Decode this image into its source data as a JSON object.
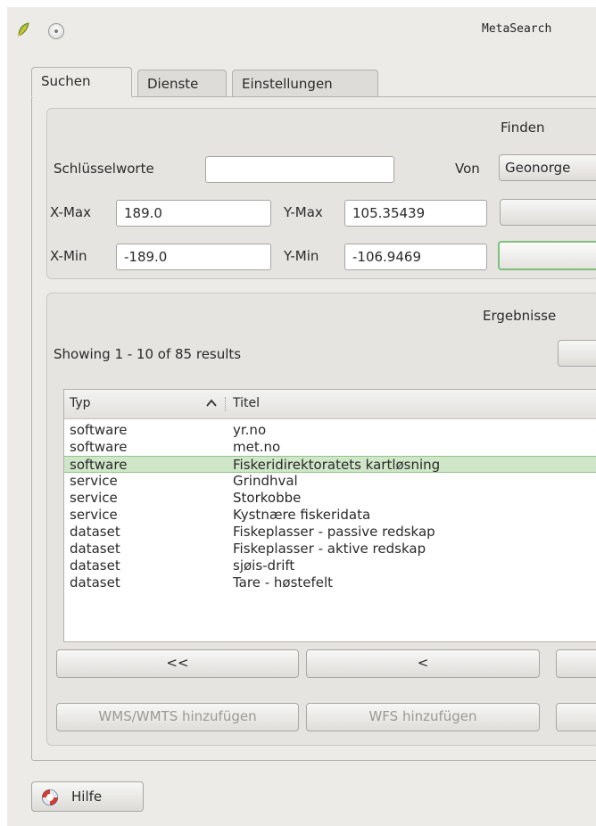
{
  "window": {
    "title": "MetaSearch"
  },
  "tabs": [
    {
      "label": "Suchen",
      "active": true
    },
    {
      "label": "Dienste",
      "active": false
    },
    {
      "label": "Einstellungen",
      "active": false
    }
  ],
  "search": {
    "group_title": "Finden",
    "keywords_label": "Schlüsselworte",
    "keywords_value": "",
    "from_label": "Von",
    "from_value": "Geonorge",
    "xmax_label": "X-Max",
    "xmax_value": "189.0",
    "ymax_label": "Y-Max",
    "ymax_value": "105.35439",
    "xmin_label": "X-Min",
    "xmin_value": "-189.0",
    "ymin_label": "Y-Min",
    "ymin_value": "-106.9469"
  },
  "results": {
    "group_title": "Ergebnisse",
    "summary": "Showing 1 - 10 of 85 results",
    "columns": [
      "Typ",
      "Titel"
    ],
    "rows": [
      {
        "type": "software",
        "title": "yr.no"
      },
      {
        "type": "software",
        "title": "met.no"
      },
      {
        "type": "software",
        "title": "Fiskeridirektoratets kartløsning"
      },
      {
        "type": "service",
        "title": "Grindhval"
      },
      {
        "type": "service",
        "title": "Storkobbe"
      },
      {
        "type": "service",
        "title": "Kystnære fiskeridata"
      },
      {
        "type": "dataset",
        "title": "Fiskeplasser - passive redskap"
      },
      {
        "type": "dataset",
        "title": "Fiskeplasser - aktive redskap"
      },
      {
        "type": "dataset",
        "title": "sjøis-drift"
      },
      {
        "type": "dataset",
        "title": "Tare - høstefelt"
      }
    ],
    "selected_index": 2,
    "nav_first": "<<",
    "nav_prev": "<",
    "add_wms": "WMS/WMTS hinzufügen",
    "add_wfs": "WFS hinzufügen"
  },
  "footer": {
    "help_label": "Hilfe"
  },
  "colors": {
    "selection": "#cfe7c8",
    "selection_border": "#8fc48a",
    "window_bg": "#ecebe8"
  }
}
